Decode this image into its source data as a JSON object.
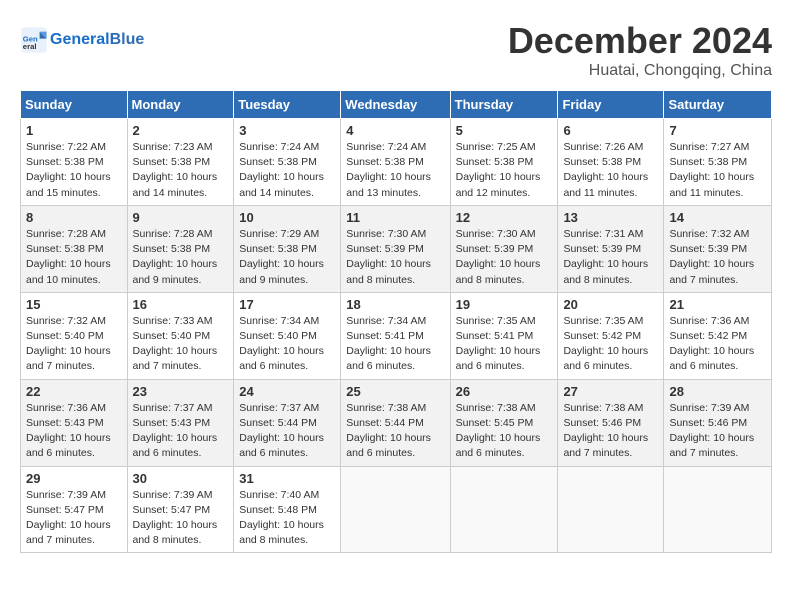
{
  "header": {
    "logo_text_general": "General",
    "logo_text_blue": "Blue",
    "month": "December 2024",
    "location": "Huatai, Chongqing, China"
  },
  "weekdays": [
    "Sunday",
    "Monday",
    "Tuesday",
    "Wednesday",
    "Thursday",
    "Friday",
    "Saturday"
  ],
  "weeks": [
    [
      {
        "day": "1",
        "info": "Sunrise: 7:22 AM\nSunset: 5:38 PM\nDaylight: 10 hours\nand 15 minutes."
      },
      {
        "day": "2",
        "info": "Sunrise: 7:23 AM\nSunset: 5:38 PM\nDaylight: 10 hours\nand 14 minutes."
      },
      {
        "day": "3",
        "info": "Sunrise: 7:24 AM\nSunset: 5:38 PM\nDaylight: 10 hours\nand 14 minutes."
      },
      {
        "day": "4",
        "info": "Sunrise: 7:24 AM\nSunset: 5:38 PM\nDaylight: 10 hours\nand 13 minutes."
      },
      {
        "day": "5",
        "info": "Sunrise: 7:25 AM\nSunset: 5:38 PM\nDaylight: 10 hours\nand 12 minutes."
      },
      {
        "day": "6",
        "info": "Sunrise: 7:26 AM\nSunset: 5:38 PM\nDaylight: 10 hours\nand 11 minutes."
      },
      {
        "day": "7",
        "info": "Sunrise: 7:27 AM\nSunset: 5:38 PM\nDaylight: 10 hours\nand 11 minutes."
      }
    ],
    [
      {
        "day": "8",
        "info": "Sunrise: 7:28 AM\nSunset: 5:38 PM\nDaylight: 10 hours\nand 10 minutes."
      },
      {
        "day": "9",
        "info": "Sunrise: 7:28 AM\nSunset: 5:38 PM\nDaylight: 10 hours\nand 9 minutes."
      },
      {
        "day": "10",
        "info": "Sunrise: 7:29 AM\nSunset: 5:38 PM\nDaylight: 10 hours\nand 9 minutes."
      },
      {
        "day": "11",
        "info": "Sunrise: 7:30 AM\nSunset: 5:39 PM\nDaylight: 10 hours\nand 8 minutes."
      },
      {
        "day": "12",
        "info": "Sunrise: 7:30 AM\nSunset: 5:39 PM\nDaylight: 10 hours\nand 8 minutes."
      },
      {
        "day": "13",
        "info": "Sunrise: 7:31 AM\nSunset: 5:39 PM\nDaylight: 10 hours\nand 8 minutes."
      },
      {
        "day": "14",
        "info": "Sunrise: 7:32 AM\nSunset: 5:39 PM\nDaylight: 10 hours\nand 7 minutes."
      }
    ],
    [
      {
        "day": "15",
        "info": "Sunrise: 7:32 AM\nSunset: 5:40 PM\nDaylight: 10 hours\nand 7 minutes."
      },
      {
        "day": "16",
        "info": "Sunrise: 7:33 AM\nSunset: 5:40 PM\nDaylight: 10 hours\nand 7 minutes."
      },
      {
        "day": "17",
        "info": "Sunrise: 7:34 AM\nSunset: 5:40 PM\nDaylight: 10 hours\nand 6 minutes."
      },
      {
        "day": "18",
        "info": "Sunrise: 7:34 AM\nSunset: 5:41 PM\nDaylight: 10 hours\nand 6 minutes."
      },
      {
        "day": "19",
        "info": "Sunrise: 7:35 AM\nSunset: 5:41 PM\nDaylight: 10 hours\nand 6 minutes."
      },
      {
        "day": "20",
        "info": "Sunrise: 7:35 AM\nSunset: 5:42 PM\nDaylight: 10 hours\nand 6 minutes."
      },
      {
        "day": "21",
        "info": "Sunrise: 7:36 AM\nSunset: 5:42 PM\nDaylight: 10 hours\nand 6 minutes."
      }
    ],
    [
      {
        "day": "22",
        "info": "Sunrise: 7:36 AM\nSunset: 5:43 PM\nDaylight: 10 hours\nand 6 minutes."
      },
      {
        "day": "23",
        "info": "Sunrise: 7:37 AM\nSunset: 5:43 PM\nDaylight: 10 hours\nand 6 minutes."
      },
      {
        "day": "24",
        "info": "Sunrise: 7:37 AM\nSunset: 5:44 PM\nDaylight: 10 hours\nand 6 minutes."
      },
      {
        "day": "25",
        "info": "Sunrise: 7:38 AM\nSunset: 5:44 PM\nDaylight: 10 hours\nand 6 minutes."
      },
      {
        "day": "26",
        "info": "Sunrise: 7:38 AM\nSunset: 5:45 PM\nDaylight: 10 hours\nand 6 minutes."
      },
      {
        "day": "27",
        "info": "Sunrise: 7:38 AM\nSunset: 5:46 PM\nDaylight: 10 hours\nand 7 minutes."
      },
      {
        "day": "28",
        "info": "Sunrise: 7:39 AM\nSunset: 5:46 PM\nDaylight: 10 hours\nand 7 minutes."
      }
    ],
    [
      {
        "day": "29",
        "info": "Sunrise: 7:39 AM\nSunset: 5:47 PM\nDaylight: 10 hours\nand 7 minutes."
      },
      {
        "day": "30",
        "info": "Sunrise: 7:39 AM\nSunset: 5:47 PM\nDaylight: 10 hours\nand 8 minutes."
      },
      {
        "day": "31",
        "info": "Sunrise: 7:40 AM\nSunset: 5:48 PM\nDaylight: 10 hours\nand 8 minutes."
      },
      {
        "day": "",
        "info": ""
      },
      {
        "day": "",
        "info": ""
      },
      {
        "day": "",
        "info": ""
      },
      {
        "day": "",
        "info": ""
      }
    ]
  ]
}
